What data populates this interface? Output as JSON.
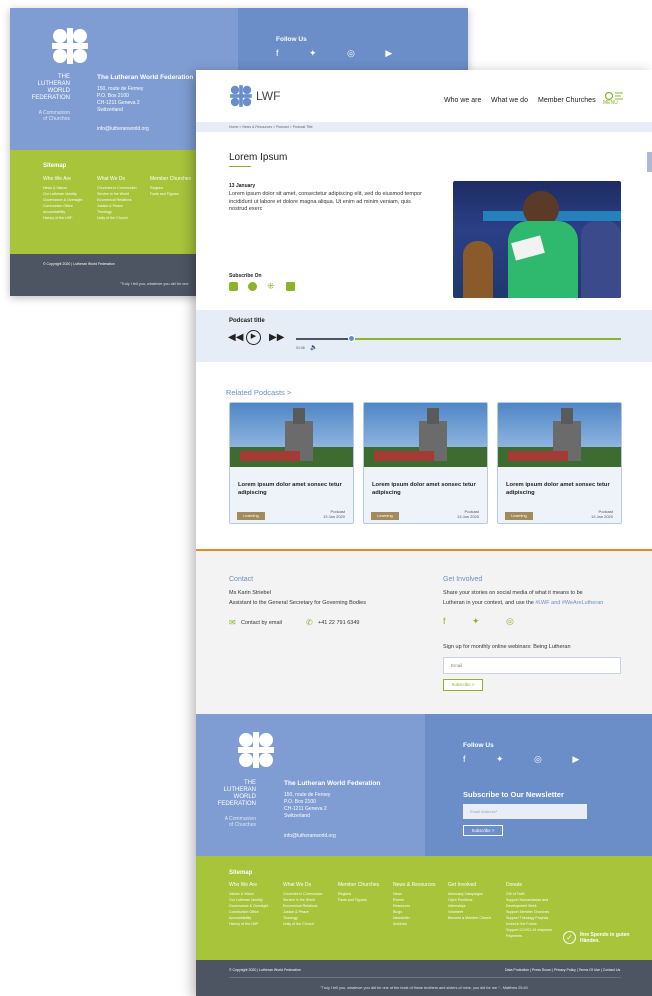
{
  "back": {
    "org_name_lines": [
      "THE",
      "LUTHERAN",
      "WORLD",
      "FEDERATION"
    ],
    "communion_lines": [
      "A Communion",
      "of Churches"
    ],
    "address_title": "The Lutheran World Federation",
    "address_lines": [
      "150, route de Ferney",
      "P.O. Box 2100",
      "CH-1211 Geneva 2",
      "Switzerland"
    ],
    "email": "info@lutheranworld.org",
    "follow": "Follow Us",
    "sitemap": "Sitemap",
    "col1_title": "Who We Are",
    "col1_items": [
      "News & Values",
      "Our Lutheran Identity",
      "Governance & Oversight",
      "Communion Office",
      "Accountability",
      "History of the LWF"
    ],
    "col2_title": "What We Do",
    "col2_items": [
      "Churches in Communion",
      "Service in the World",
      "Ecumenical Relations",
      "Justice & Peace",
      "Theology",
      "Unity of the Church"
    ],
    "col3_title": "Member Churches",
    "col3_items": [
      "Regions",
      "Facts and Figures"
    ],
    "copyright": "© Copyright 2020 | Lutheran World Federation",
    "quote": "\"Truly I tell you, whatever you did for one"
  },
  "header": {
    "logo_text": "LWF",
    "nav": [
      "Who we are",
      "What we do",
      "Member Churches"
    ],
    "menu": "MENU"
  },
  "breadcrumb": "Home > News & Resources > Podcast > Podcast Title",
  "article": {
    "title": "Lorem Ipsum",
    "date": "13 January",
    "body": "Lorem ipsum dolor sit amet, consectetur adipiscing elit, sed do eiusmod tempor incididunt ut labore et dolore magna aliqua. Ut enim ad minim veniam, quis nostrud exerc",
    "subscribe_on": "Subscribe On"
  },
  "player": {
    "title": "Podcast title",
    "time": "01:06",
    "progress": 0.17
  },
  "related": {
    "heading": "Related Podcasts >",
    "cards": [
      {
        "title": "Lorem ipsum dolor amet sonsec tetur adipiscing",
        "tag": "Learning",
        "type": "Podcast",
        "date": "13 Jan 2020"
      },
      {
        "title": "Lorem ipsum dolor amet sonsec tetur adipiscing",
        "tag": "Learning",
        "type": "Podcast",
        "date": "13 Jan 2020"
      },
      {
        "title": "Lorem ipsum dolor amet sonsec tetur adipiscing",
        "tag": "Learning",
        "type": "Podcast",
        "date": "13 Jan 2020"
      }
    ]
  },
  "contact": {
    "heading": "Contact",
    "name": "Ms Karin Striebel",
    "role": "Assistant to the General Secretary for Governing Bodies",
    "email_label": "Contact by email",
    "phone": "+41 22 791 6349"
  },
  "involved": {
    "heading": "Get Involved",
    "text1": "Share your stories on social media of what it means to be",
    "text2": "Lutheran in your context, and use the ",
    "tags": "#LWF and #WeAreLutheran",
    "webinar": "Sign up for monthly online webinars: Being Lutheran",
    "email_placeholder": "Email",
    "subscribe": "Subscribe >"
  },
  "footer": {
    "org_name_lines": [
      "THE",
      "LUTHERAN",
      "WORLD",
      "FEDERATION"
    ],
    "communion_lines": [
      "A Communion",
      "of Churches"
    ],
    "address_title": "The Lutheran World Federation",
    "address_lines": [
      "150, route de Ferney",
      "P.O. Box 2100",
      "CH-1211 Geneva 2",
      "Switzerland"
    ],
    "email": "info@lutheranworld.org",
    "follow": "Follow Us",
    "newsletter": "Subscribe to Our Newsletter",
    "newsletter_placeholder": "Email Address*",
    "newsletter_btn": "Subscribe >",
    "sitemap": "Sitemap",
    "columns": [
      {
        "title": "Who We Are",
        "items": [
          "Values & Vision",
          "Our Lutheran Identity",
          "Governance & Oversight",
          "Communion Office",
          "Accountability",
          "History of the LWF"
        ]
      },
      {
        "title": "What We Do",
        "items": [
          "Churches in Communion",
          "Service in the World",
          "Ecumenical Relations",
          "Justice & Peace",
          "Theology",
          "Unity of the Church"
        ]
      },
      {
        "title": "Member Churches",
        "items": [
          "Regions",
          "Facts and Figures"
        ]
      },
      {
        "title": "News & Resources",
        "items": [
          "News",
          "Events",
          "Resources",
          "Blogs",
          "Newsletter",
          "Archives"
        ]
      },
      {
        "title": "Get Involved",
        "items": [
          "Advocacy Campaigns",
          "Open Positions",
          "Internships",
          "Volunteer",
          "Become a Member Church"
        ]
      },
      {
        "title": "Donate",
        "items": [
          "Gift of Faith",
          "Support Humanitarian and",
          "Development Work",
          "Support Member Churches",
          "Support Theology Projects",
          "Invest in the Future",
          "Support COVID-19 response",
          "Payments"
        ]
      }
    ],
    "donate_badge": "Ihre Spende in guten Händen.",
    "copyright": "© Copyright 2020 | Lutheran World Federation",
    "legal": "Data Protection | Press Room | Privacy Policy | Terms Of Use | Contact Us",
    "quote": "\"Truly I tell you, whatever you did for one of the least of these brothers and sisters of mine, you did for me.\" - Matthew 25:40"
  }
}
